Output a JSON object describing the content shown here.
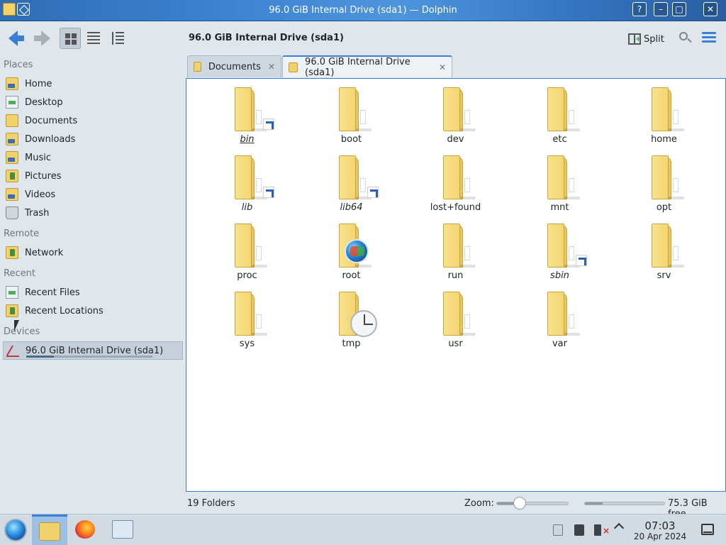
{
  "window": {
    "title": "96.0 GiB Internal Drive (sda1) — Dolphin",
    "buttons": {
      "help": "?",
      "minimize": "–",
      "maximize": "□",
      "close": "✕"
    }
  },
  "toolbar": {
    "location_title": "96.0 GiB Internal Drive (sda1)",
    "split_label": "Split",
    "icons": [
      "back-icon",
      "forward-icon",
      "icons-view-icon",
      "compact-view-icon",
      "details-view-icon",
      "search-icon",
      "menu-icon"
    ]
  },
  "sidebar": {
    "places_heading": "Places",
    "places": [
      {
        "label": "Home",
        "icon": "home-folder-icon"
      },
      {
        "label": "Desktop",
        "icon": "desktop-folder-icon"
      },
      {
        "label": "Documents",
        "icon": "documents-folder-icon"
      },
      {
        "label": "Downloads",
        "icon": "downloads-folder-icon"
      },
      {
        "label": "Music",
        "icon": "music-folder-icon"
      },
      {
        "label": "Pictures",
        "icon": "pictures-folder-icon"
      },
      {
        "label": "Videos",
        "icon": "videos-folder-icon"
      },
      {
        "label": "Trash",
        "icon": "trash-icon"
      }
    ],
    "remote_heading": "Remote",
    "remote": [
      {
        "label": "Network",
        "icon": "network-folder-icon"
      }
    ],
    "recent_heading": "Recent",
    "recent": [
      {
        "label": "Recent Files",
        "icon": "recent-files-icon"
      },
      {
        "label": "Recent Locations",
        "icon": "recent-locations-icon"
      }
    ],
    "devices_heading": "Devices",
    "devices": [
      {
        "label": "96.0 GiB Internal Drive (sda1)",
        "icon": "drive-icon",
        "used_fraction": 0.22
      }
    ]
  },
  "tabs": [
    {
      "label": "Documents",
      "close": "✕",
      "active": false
    },
    {
      "label": "96.0 GiB Internal Drive (sda1)",
      "close": "✕",
      "active": true
    }
  ],
  "folders": [
    {
      "name": "bin",
      "symlink": true
    },
    {
      "name": "boot",
      "symlink": false
    },
    {
      "name": "dev",
      "symlink": false
    },
    {
      "name": "etc",
      "symlink": false
    },
    {
      "name": "home",
      "symlink": false
    },
    {
      "name": "lib",
      "symlink": true
    },
    {
      "name": "lib64",
      "symlink": true
    },
    {
      "name": "lost+found",
      "symlink": false
    },
    {
      "name": "mnt",
      "symlink": false
    },
    {
      "name": "opt",
      "symlink": false
    },
    {
      "name": "proc",
      "symlink": false
    },
    {
      "name": "root",
      "symlink": false,
      "emblem": "root"
    },
    {
      "name": "run",
      "symlink": false
    },
    {
      "name": "sbin",
      "symlink": true
    },
    {
      "name": "srv",
      "symlink": false
    },
    {
      "name": "sys",
      "symlink": false
    },
    {
      "name": "tmp",
      "symlink": false,
      "emblem": "clock"
    },
    {
      "name": "usr",
      "symlink": false
    },
    {
      "name": "var",
      "symlink": false
    }
  ],
  "status": {
    "count": "19 Folders",
    "zoom_label": "Zoom:",
    "zoom_fraction": 0.3,
    "free_space": "75.3 GiB free",
    "used_fraction": 0.22
  },
  "taskbar": {
    "tasks": [
      "application-launcher-icon",
      "dolphin-task-icon",
      "firefox-task-icon",
      "system-settings-task-icon"
    ],
    "time": "07:03",
    "date": "20 Apr 2024"
  },
  "colors": {
    "accent": "#3b7ed6",
    "folder": "#f1d16c",
    "background": "#dfe6ec"
  }
}
